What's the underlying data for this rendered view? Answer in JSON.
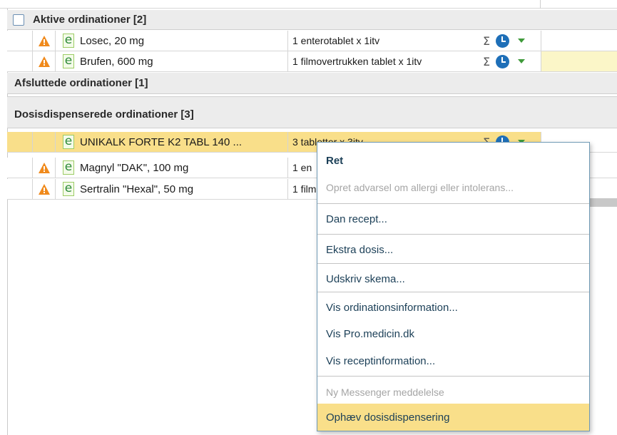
{
  "groups": {
    "active": "Aktive ordinationer [2]",
    "ended": "Afsluttede ordinationer [1]",
    "dose_dispensed": "Dosisdispenserede ordinationer [3]"
  },
  "active_rows": [
    {
      "name": "Losec, 20 mg",
      "dose": "1 enterotablet x 1itv",
      "warning": true
    },
    {
      "name": "Brufen, 600 mg",
      "dose": "1 filmovertrukken tablet x 1itv",
      "warning": true
    }
  ],
  "dose_rows": [
    {
      "name": "UNIKALK FORTE K2 TABL 140 ...",
      "dose": "3 tabletter x 3itv",
      "warning": false,
      "selected": true
    },
    {
      "name": "Magnyl \"DAK\", 100 mg",
      "dose": "1 en",
      "warning": true
    },
    {
      "name": "Sertralin \"Hexal\", 50 mg",
      "dose": "1 film",
      "warning": true
    }
  ],
  "icons": {
    "sigma": "Σ",
    "e_icon": "e",
    "warning_icon": "warning-icon",
    "clock_icon": "clock-icon",
    "dropdown_icon": "dropdown-arrow-icon"
  },
  "context_menu": {
    "items": [
      {
        "label": "Ret",
        "style": "bold"
      },
      {
        "label": "Opret advarsel om allergi eller intolerans...",
        "style": "disabled"
      },
      {
        "label": "Dan recept..."
      },
      {
        "label": "Ekstra dosis..."
      },
      {
        "label": "Udskriv skema..."
      },
      {
        "label": "Vis ordinationsinformation..."
      },
      {
        "label": "Vis Pro.medicin.dk"
      },
      {
        "label": "Vis receptinformation..."
      },
      {
        "label": "Ny Messenger meddelelse",
        "style": "disabled"
      },
      {
        "label": "Ophæv dosisdispensering",
        "style": "highlighted"
      }
    ]
  },
  "colors": {
    "selected_row": "#f9df8a",
    "accent_blue": "#1e6fb8",
    "warning_orange": "#f08a1c"
  }
}
